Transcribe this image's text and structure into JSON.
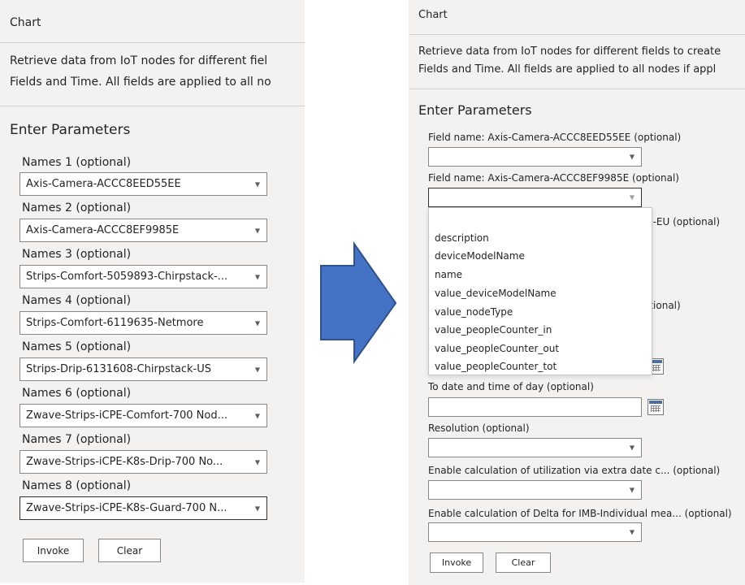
{
  "left": {
    "title": "Chart",
    "description_line1": "Retrieve data from IoT nodes for different fiel",
    "description_line2": "Fields and Time. All fields are applied to all no",
    "section_title": "Enter Parameters",
    "fields": [
      {
        "label": "Names 1 (optional)",
        "value": "Axis-Camera-ACCC8EED55EE"
      },
      {
        "label": "Names 2 (optional)",
        "value": "Axis-Camera-ACCC8EF9985E"
      },
      {
        "label": "Names 3 (optional)",
        "value": "Strips-Comfort-5059893-Chirpstack-..."
      },
      {
        "label": "Names 4 (optional)",
        "value": "Strips-Comfort-6119635-Netmore"
      },
      {
        "label": "Names 5 (optional)",
        "value": "Strips-Drip-6131608-Chirpstack-US"
      },
      {
        "label": "Names 6 (optional)",
        "value": "Zwave-Strips-iCPE-Comfort-700 Nod..."
      },
      {
        "label": "Names 7 (optional)",
        "value": "Zwave-Strips-iCPE-K8s-Drip-700 No..."
      },
      {
        "label": "Names 8 (optional)",
        "value": "Zwave-Strips-iCPE-K8s-Guard-700 N..."
      }
    ],
    "invoke_label": "Invoke",
    "clear_label": "Clear"
  },
  "right": {
    "title": "Chart",
    "description_line1": "Retrieve data from IoT nodes for different fields to create",
    "description_line2": "Fields and Time. All fields are applied to all nodes if appl",
    "section_title": "Enter Parameters",
    "field1_label": "Field name: Axis-Camera-ACCC8EED55EE (optional)",
    "field2_label": "Field name: Axis-Camera-ACCC8EF9985E (optional)",
    "hidden_label_fragment_1": "tack-EU (optional)",
    "hidden_label_fragment_2": "otional)",
    "dropdown_options": [
      "description",
      "deviceModelName",
      "name",
      "value_deviceModelName",
      "value_nodeType",
      "value_peopleCounter_in",
      "value_peopleCounter_out",
      "value_peopleCounter_tot"
    ],
    "to_date_label": "To date and time of day (optional)",
    "resolution_label": "Resolution (optional)",
    "utilization_label": "Enable calculation of utilization via extra date c... (optional)",
    "delta_label": "Enable calculation of Delta for IMB-Individual mea... (optional)",
    "invoke_label": "Invoke",
    "clear_label": "Clear"
  },
  "colors": {
    "panel_bg": "#f3f2f1",
    "arrow_fill": "#4472c4",
    "arrow_stroke": "#2f528f"
  },
  "icons": {
    "chevron": "chevron-down-icon",
    "calendar": "calendar-icon",
    "arrow": "right-arrow-icon"
  }
}
